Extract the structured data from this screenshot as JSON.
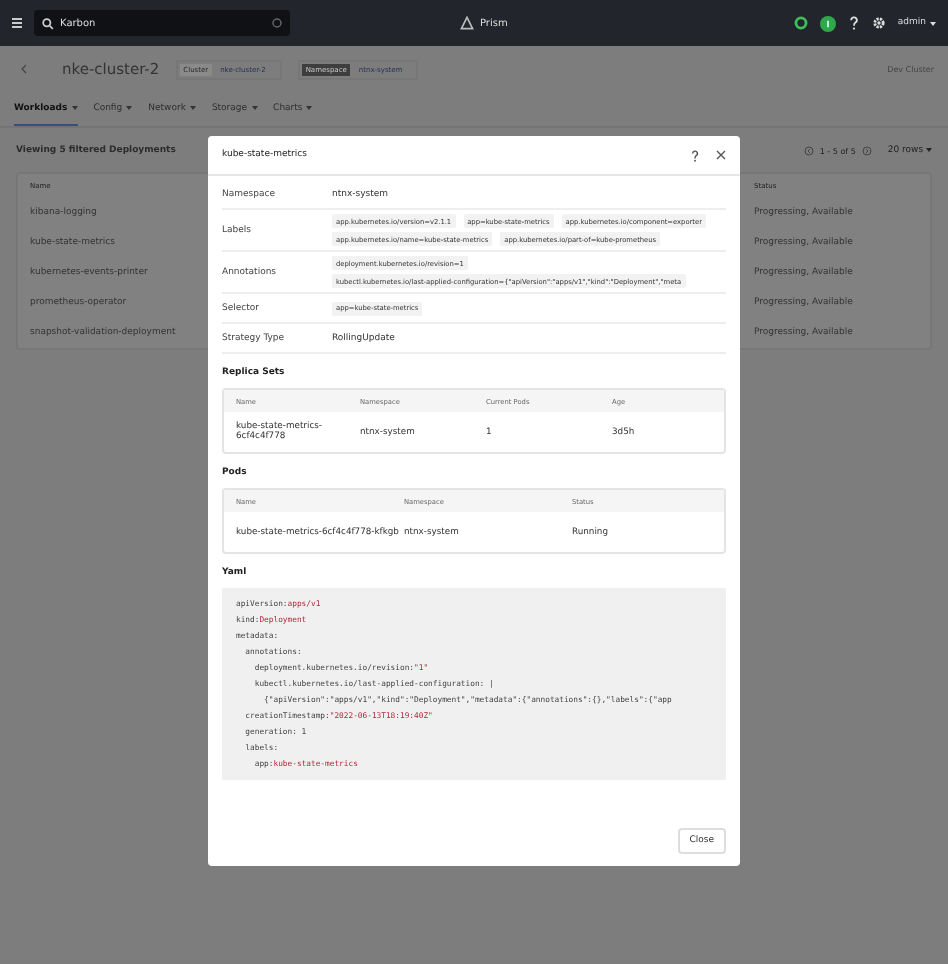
{
  "topbar": {
    "search": {
      "value": "Karbon"
    },
    "app_name": "Prism",
    "user": "admin"
  },
  "header": {
    "cluster_title": "nke-cluster-2",
    "cluster_tag": "Cluster",
    "cluster_value": "nke-cluster-2",
    "namespace_tag": "Namespace",
    "namespace_value": "ntnx-system",
    "right_button": "Dev Cluster"
  },
  "tabs": [
    {
      "label": "Workloads",
      "selected": true
    },
    {
      "label": "Config",
      "selected": false
    },
    {
      "label": "Network",
      "selected": false
    },
    {
      "label": "Storage",
      "selected": false
    },
    {
      "label": "Charts",
      "selected": false
    }
  ],
  "list": {
    "heading": "Viewing 5 filtered Deployments",
    "pagination": "1 - 5 of 5",
    "rows_per_page": "20 rows",
    "columns": [
      "Name",
      "Status"
    ],
    "rows": [
      {
        "name": "kibana-logging",
        "status": "Progressing, Available"
      },
      {
        "name": "kube-state-metrics",
        "status": "Progressing, Available"
      },
      {
        "name": "kubernetes-events-printer",
        "status": "Progressing, Available"
      },
      {
        "name": "prometheus-operator",
        "status": "Progressing, Available"
      },
      {
        "name": "snapshot-validation-deployment",
        "status": "Progressing, Available"
      }
    ]
  },
  "modal": {
    "title": "kube-state-metrics",
    "fields": [
      {
        "label": "Namespace",
        "kind": "text",
        "value": "ntnx-system"
      },
      {
        "label": "Labels",
        "kind": "chips",
        "chips": [
          "app.kubernetes.io/version=v2.1.1",
          "app=kube-state-metrics",
          "app.kubernetes.io/component=exporter",
          "app.kubernetes.io/name=kube-state-metrics",
          "app.kubernetes.io/part-of=kube-prometheus"
        ]
      },
      {
        "label": "Annotations",
        "kind": "chips",
        "chips": [
          "deployment.kubernetes.io/revision=1",
          "kubectl.kubernetes.io/last-applied-configuration={\"apiVersion\":\"apps/v1\",\"kind\":\"Deployment\",\"meta"
        ]
      },
      {
        "label": "Selector",
        "kind": "chips",
        "chips": [
          "app=kube-state-metrics"
        ]
      },
      {
        "label": "Strategy Type",
        "kind": "text",
        "value": "RollingUpdate"
      }
    ],
    "replica_sets": {
      "title": "Replica Sets",
      "columns": [
        "Name",
        "Namespace",
        "Current Pods",
        "Age"
      ],
      "rows": [
        [
          "kube-state-metrics-6cf4c4f778",
          "ntnx-system",
          "1",
          "3d5h"
        ]
      ]
    },
    "pods": {
      "title": "Pods",
      "columns": [
        "Name",
        "Namespace",
        "Status"
      ],
      "rows": [
        [
          "kube-state-metrics-6cf4c4f778-kfkgb",
          "ntnx-system",
          "Running"
        ]
      ]
    },
    "yaml": {
      "title": "Yaml",
      "lines": [
        {
          "key": "apiVersion:",
          "value": "apps/v1"
        },
        {
          "key": "kind:",
          "value": "Deployment"
        },
        {
          "key": "metadata:"
        },
        {
          "key": "  annotations:"
        },
        {
          "key": "    deployment.kubernetes.io/revision:",
          "value": "\"1\""
        },
        {
          "key": "    kubectl.kubernetes.io/last-applied-configuration: |"
        },
        {
          "key": "      {\"apiVersion\":\"apps/v1\",\"kind\":\"Deployment\",\"metadata\":{\"annotations\":{},\"labels\":{\"app"
        },
        {
          "key": "  creationTimestamp:",
          "value": "\"2022-06-13T18:19:40Z\""
        },
        {
          "key": "  generation: 1"
        },
        {
          "key": "  labels:"
        },
        {
          "key": "    app:",
          "value": "kube-state-metrics"
        }
      ]
    },
    "close_button": "Close"
  }
}
